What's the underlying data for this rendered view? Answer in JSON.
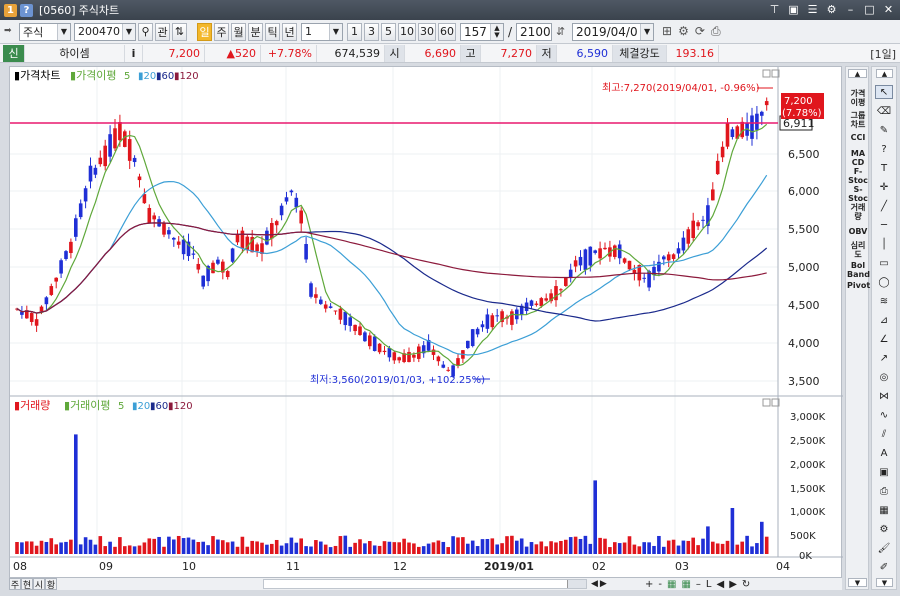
{
  "window": {
    "code": "[0560]",
    "title": "주식차트",
    "icon_labels": [
      "1",
      "?"
    ],
    "controls": [
      "pin-icon",
      "save-icon",
      "list-icon",
      "gear-icon",
      "minimize-icon",
      "maximize-icon",
      "close-icon"
    ]
  },
  "toolbar": {
    "market": "주식",
    "stock_code": "200470",
    "related_label": "관",
    "period_buttons": [
      "일",
      "주",
      "월",
      "분",
      "틱",
      "년"
    ],
    "active_period": "일",
    "interval_value": "1",
    "interval_buttons": [
      "1",
      "3",
      "5",
      "10",
      "30",
      "60"
    ],
    "count_value": "157",
    "slash": "/",
    "total_value": "2100",
    "date_value": "2019/04/0"
  },
  "infobar": {
    "type_label": "신",
    "name": "하이셈",
    "info_icon": "i",
    "price": "7,200",
    "change": "▲520",
    "change_pct": "+7.78%",
    "volume": "674,539",
    "open_label": "시",
    "open": "6,690",
    "high_label": "고",
    "high": "7,270",
    "low_label": "저",
    "low": "6,590",
    "strength_label": "체결강도",
    "strength": "193.16",
    "period_badge": "[1일]"
  },
  "price_panel": {
    "legend_main": "가격차트",
    "legend_ma": "가격이평",
    "ma_periods": [
      "5",
      "20",
      "60",
      "120"
    ],
    "y_ticks": [
      "6,500",
      "6,000",
      "5,500",
      "5,000",
      "4,500",
      "4,000",
      "3,500"
    ],
    "current_price_label": "7,200",
    "current_pct_label": "(7.78%)",
    "line_value_label": "6,911",
    "high_annotation": "최고:7,270(2019/04/01, -0.96%)",
    "low_annotation": "최저:3,560(2019/01/03, +102.25%)"
  },
  "volume_panel": {
    "legend_main": "거래량",
    "legend_ma": "거래이평",
    "ma_periods": [
      "5",
      "20",
      "60",
      "120"
    ],
    "y_ticks": [
      "3,000K",
      "2,500K",
      "2,000K",
      "1,500K",
      "1,000K",
      "500K",
      "0K"
    ]
  },
  "x_axis": {
    "labels": [
      "08",
      "09",
      "10",
      "11",
      "12",
      "2019/01",
      "02",
      "03",
      "04"
    ]
  },
  "bottom_bar": {
    "tabs": [
      "주",
      "현",
      "시",
      "황"
    ],
    "nav_buttons": [
      "◀",
      "▶",
      "+",
      "-",
      "L",
      "◀",
      "▶",
      "↻"
    ]
  },
  "indicator_panel": {
    "items": [
      "가격 이평",
      "그룹 차트",
      "CCI",
      "MA CD",
      "F-Stoc",
      "S-Stoc",
      "거래량",
      "OBV",
      "심리도",
      "Bol Band",
      "Pivot"
    ]
  },
  "tool_panel": {
    "tools": [
      "cursor-tool-icon",
      "eraser-tool-icon",
      "pen-tool-icon",
      "question-tool-icon",
      "text-tool-icon",
      "crosshair-tool-icon",
      "line-tool-icon",
      "hline-tool-icon",
      "vline-tool-icon",
      "rect-tool-icon",
      "ellipse-tool-icon",
      "fibonacci-tool-icon",
      "gann-tool-icon",
      "angle-tool-icon",
      "trend-tool-icon",
      "cycle-tool-icon",
      "pattern-tool-icon",
      "wave-tool-icon",
      "channel-tool-icon",
      "auto-tool-icon",
      "window-tool-icon",
      "print-tool-icon",
      "calc-tool-icon",
      "settings-tool-icon",
      "brush-tool-icon",
      "draw-tool-icon"
    ]
  },
  "colors": {
    "up": "#e0161d",
    "down": "#1f2fd6",
    "ma5": "#5fa83a",
    "ma20": "#3c9fd6",
    "ma60": "#1b2a8c",
    "ma120": "#8c1a3c",
    "hline": "#e8186f"
  },
  "chart_data": {
    "type": "candlestick",
    "price_axis": [
      3500,
      7200
    ],
    "volume_axis": [
      0,
      3000
    ],
    "volume_unit": "K"
  }
}
